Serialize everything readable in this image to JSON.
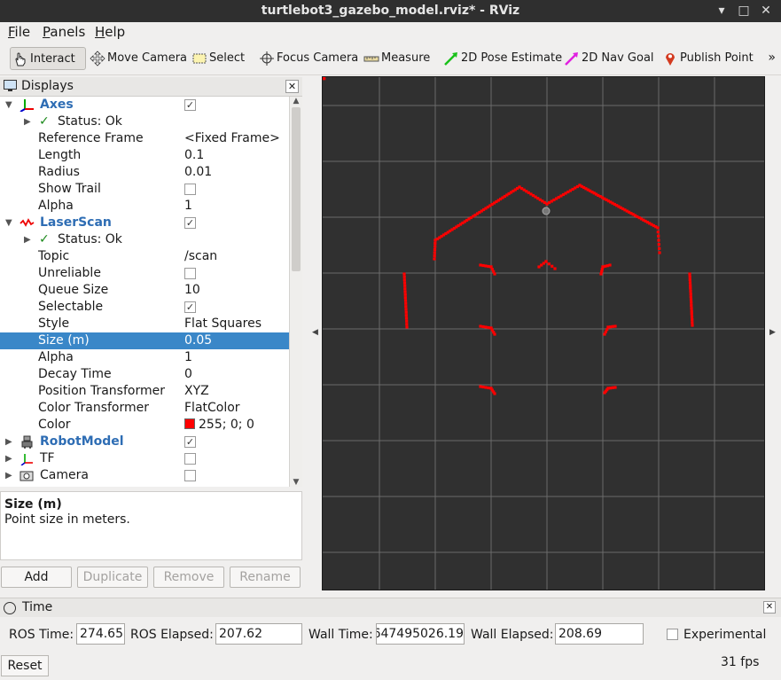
{
  "window": {
    "title": "turtlebot3_gazebo_model.rviz* - RViz",
    "minimize": "▾",
    "restore": "□",
    "close": "✕"
  },
  "menu": [
    {
      "u": "F",
      "rest": "ile"
    },
    {
      "u": "P",
      "rest": "anels"
    },
    {
      "u": "H",
      "rest": "elp"
    }
  ],
  "toolbar": {
    "interact": "Interact",
    "move_camera": "Move Camera",
    "select": "Select",
    "focus_camera": "Focus Camera",
    "measure": "Measure",
    "pose_estimate": "2D Pose Estimate",
    "nav_goal": "2D Nav Goal",
    "publish_point": "Publish Point",
    "more": "»"
  },
  "displays": {
    "title": "Displays",
    "close": "✕",
    "rows": [
      {
        "label": "Axes",
        "check": "✓"
      },
      {
        "label": "Status: Ok"
      },
      {
        "label": "Reference Frame",
        "value": "<Fixed Frame>"
      },
      {
        "label": "Length",
        "value": "0.1"
      },
      {
        "label": "Radius",
        "value": "0.01"
      },
      {
        "label": "Show Trail",
        "check": ""
      },
      {
        "label": "Alpha",
        "value": "1"
      },
      {
        "label": "LaserScan",
        "check": "✓"
      },
      {
        "label": "Status: Ok"
      },
      {
        "label": "Topic",
        "value": "/scan"
      },
      {
        "label": "Unreliable",
        "check": ""
      },
      {
        "label": "Queue Size",
        "value": "10"
      },
      {
        "label": "Selectable",
        "check": "✓"
      },
      {
        "label": "Style",
        "value": "Flat Squares"
      },
      {
        "label": "Size (m)",
        "value": "0.05"
      },
      {
        "label": "Alpha",
        "value": "1"
      },
      {
        "label": "Decay Time",
        "value": "0"
      },
      {
        "label": "Position Transformer",
        "value": "XYZ"
      },
      {
        "label": "Color Transformer",
        "value": "FlatColor"
      },
      {
        "label": "Color",
        "value": "255; 0; 0"
      },
      {
        "label": "RobotModel",
        "check": "✓"
      },
      {
        "label": "TF",
        "check": ""
      },
      {
        "label": "Camera",
        "check": ""
      }
    ]
  },
  "description": {
    "title": "Size (m)",
    "text": "Point size in meters."
  },
  "buttons": {
    "add": "Add",
    "duplicate": "Duplicate",
    "remove": "Remove",
    "rename": "Rename"
  },
  "time": {
    "title": "Time",
    "close": "✕",
    "ros_time_label": "ROS Time:",
    "ros_time": "274.65",
    "ros_elapsed_label": "ROS Elapsed:",
    "ros_elapsed": "207.62",
    "wall_time_label": "Wall Time:",
    "wall_time": "647495026.19",
    "wall_elapsed_label": "Wall Elapsed:",
    "wall_elapsed": "208.69",
    "experimental": "Experimental",
    "reset": "Reset",
    "fps": "31 fps"
  },
  "colors": {
    "laser": "#ff0000",
    "grid_bg": "#303030",
    "selection": "#3a87c8",
    "link": "#2e6db4"
  }
}
